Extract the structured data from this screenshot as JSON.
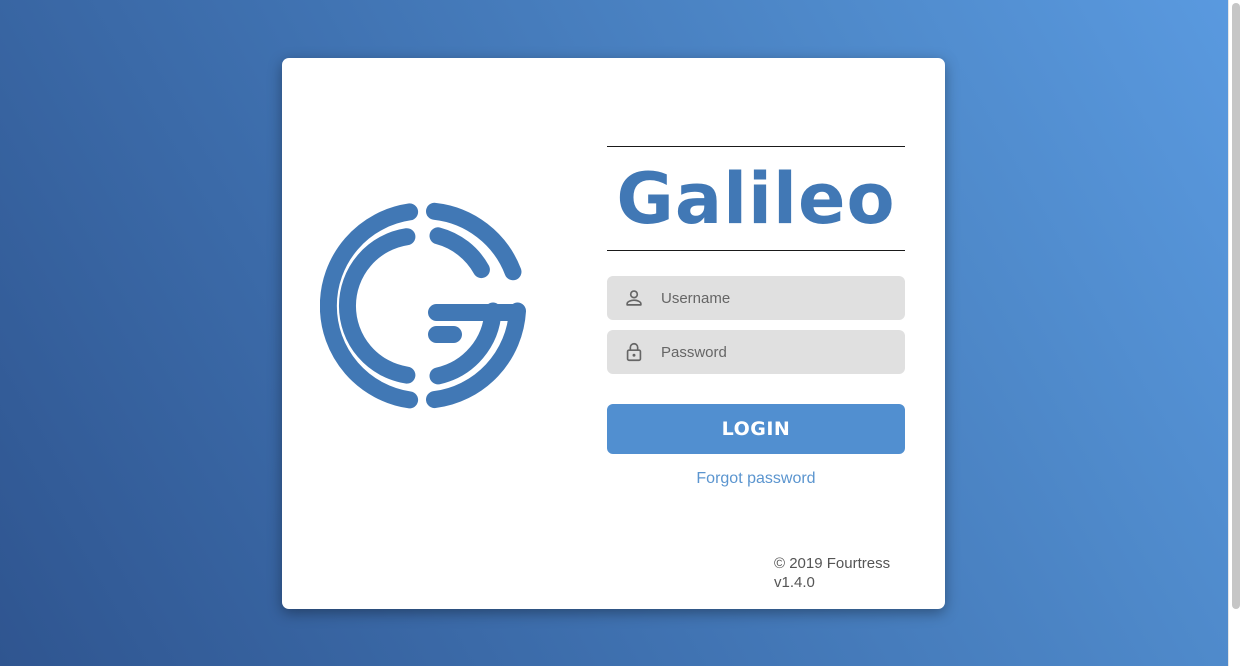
{
  "app": {
    "title": "Galileo",
    "logo_icon": "galileo-g-logo"
  },
  "login": {
    "username_placeholder": "Username",
    "username_value": "",
    "username_icon": "user-icon",
    "password_placeholder": "Password",
    "password_value": "",
    "password_icon": "lock-icon",
    "submit_label": "LOGIN",
    "forgot_label": "Forgot password"
  },
  "footer": {
    "copyright": "© 2019 Fourtress",
    "version": "v1.4.0"
  },
  "colors": {
    "brand": "#4178b5",
    "button": "#518fd0",
    "link": "#5b95cf",
    "background_start": "#2f5590",
    "background_end": "#5a9ae0",
    "input_bg": "#e0e0e0"
  }
}
